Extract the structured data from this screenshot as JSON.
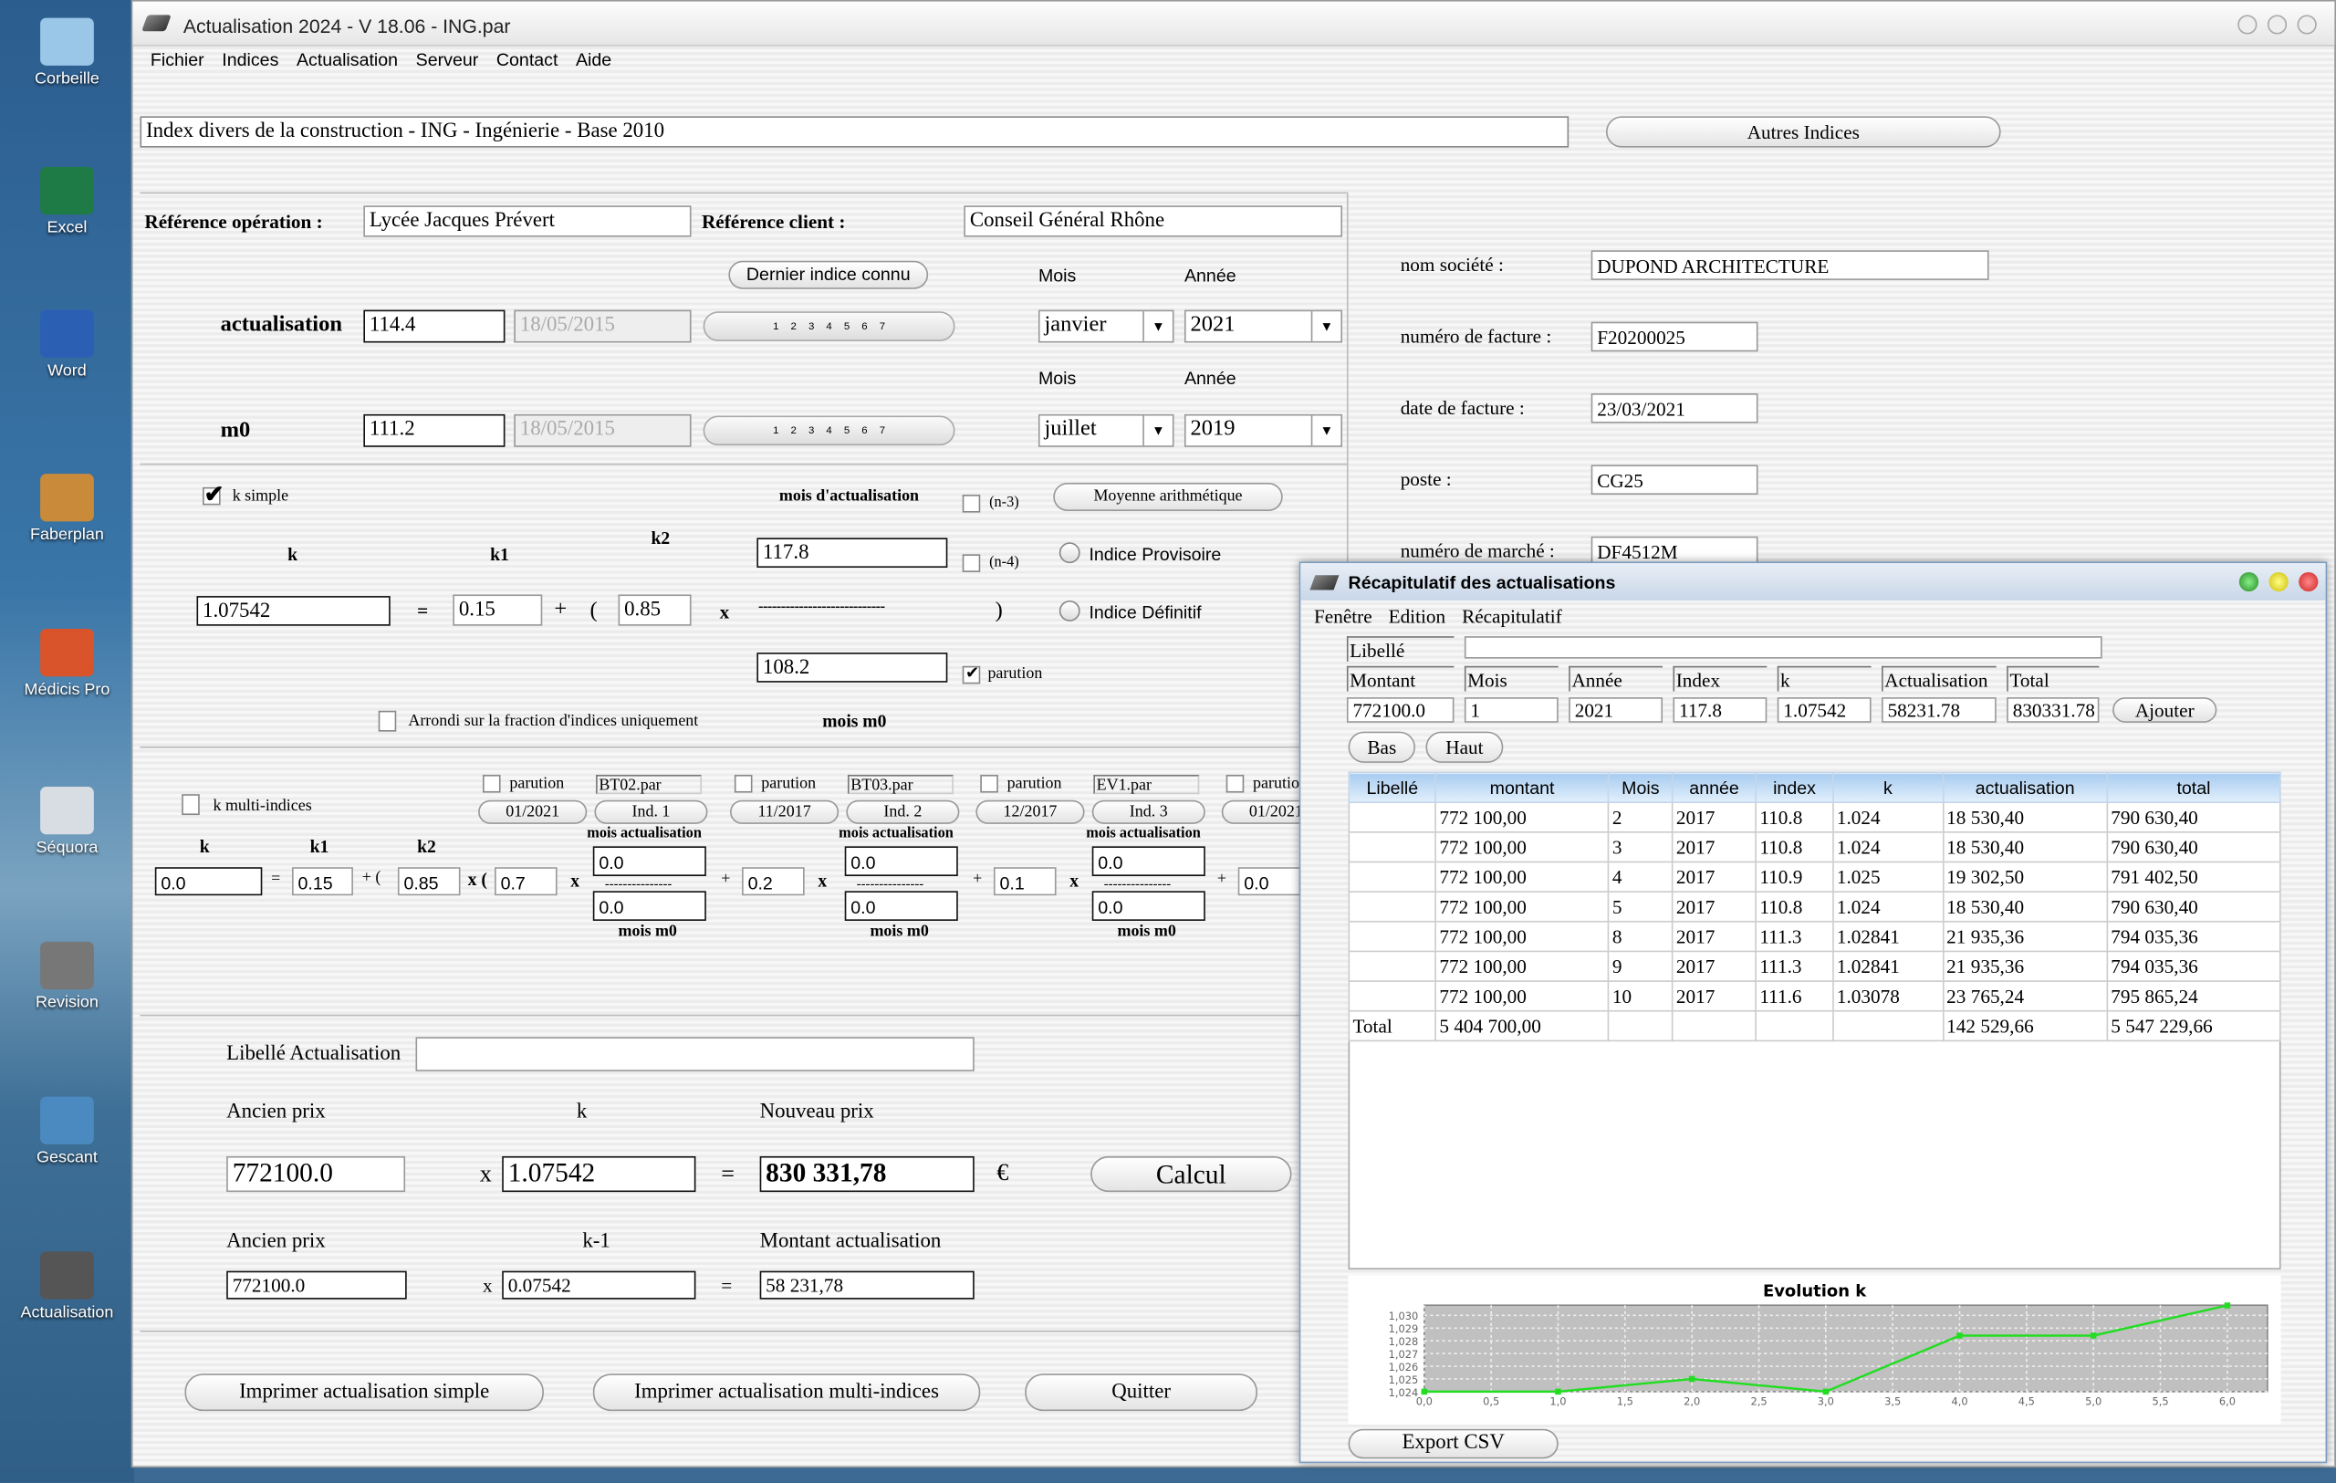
{
  "desktop": {
    "icons": [
      {
        "label": "Corbeille",
        "name": "recycle-bin-icon",
        "color": "#9ac6e8"
      },
      {
        "label": "Excel",
        "name": "excel-icon",
        "color": "#1e7b45"
      },
      {
        "label": "Word",
        "name": "word-icon",
        "color": "#2b5fb4"
      },
      {
        "label": "Faberplan",
        "name": "faberplan-icon",
        "color": "#c98a3a"
      },
      {
        "label": "Médicis Pro",
        "name": "medicis-pro-icon",
        "color": "#d9542b"
      },
      {
        "label": "Séquora",
        "name": "sequora-icon",
        "color": "#d8dde3"
      },
      {
        "label": "Revision",
        "name": "revision-icon",
        "color": "#777"
      },
      {
        "label": "Gescant",
        "name": "gescant-icon",
        "color": "#4a8ac0"
      },
      {
        "label": "Actualisation",
        "name": "actualisation-icon",
        "color": "#555"
      }
    ]
  },
  "window": {
    "title": "Actualisation 2024 - V 18.06 - ING.par",
    "menu": [
      "Fichier",
      "Indices",
      "Actualisation",
      "Serveur",
      "Contact",
      "Aide"
    ]
  },
  "index_name": "Index divers de la construction - ING - Ingénierie - Base 2010",
  "autres_indices": "Autres Indices",
  "ref": {
    "op_label": "Référence opération :",
    "op_value": "Lycée Jacques Prévert",
    "client_label": "Référence client :",
    "client_value": "Conseil Général Rhône"
  },
  "dernier_indice": "Dernier indice connu",
  "mois_label": "Mois",
  "annee_label": "Année",
  "pill_numbers": [
    "1",
    "2",
    "3",
    "4",
    "5",
    "6",
    "7"
  ],
  "actualisation": {
    "label": "actualisation",
    "value": "114.4",
    "date": "18/05/2015",
    "mois": "janvier",
    "annee": "2021"
  },
  "m0": {
    "label": "m0",
    "value": "111.2",
    "date": "18/05/2015",
    "mois": "juillet",
    "annee": "2019"
  },
  "simple": {
    "k_simple": "k simple",
    "k_simple_checked": true,
    "mois_actualisation": "mois d'actualisation",
    "n3": "(n-3)",
    "n4": "(n-4)",
    "moyenne": "Moyenne arithmétique",
    "k": "k",
    "k1": "k1",
    "k2": "k2",
    "k_value": "1.07542",
    "k1_value": "0.15",
    "k2_value": "0.85",
    "num": "117.8",
    "den": "108.2",
    "dashes": "----------------------------",
    "eq": "=",
    "plus": "+",
    "open": "(",
    "close": ")",
    "times": "x",
    "provisoire": "Indice Provisoire",
    "definitif": "Indice Définitif",
    "parution": "parution",
    "parution_checked": true,
    "arrondi": "Arrondi sur la fraction d'indices uniquement",
    "mois_m0": "mois m0"
  },
  "multi": {
    "label": "k multi-indices",
    "k": "k",
    "k1": "k1",
    "k2": "k2",
    "k_value": "0.0",
    "k1_value": "0.15",
    "k2_value": "0.85",
    "paren": "x (",
    "groups": [
      {
        "parution": "parution",
        "file": "BT02.par",
        "date": "01/2021",
        "ind": "Ind. 1",
        "coef": "0.7",
        "num": "0.0",
        "den": "0.0"
      },
      {
        "parution": "parution",
        "file": "BT03.par",
        "date": "11/2017",
        "ind": "Ind. 2",
        "coef": "0.2",
        "num": "0.0",
        "den": "0.0"
      },
      {
        "parution": "parution",
        "file": "EV1.par",
        "date": "12/2017",
        "ind": "Ind. 3",
        "coef": "0.1",
        "num": "0.0",
        "den": "0.0"
      },
      {
        "parution": "parutio",
        "date": "01/2021",
        "coef": "0.0"
      }
    ],
    "mois_act": "mois actualisation",
    "mois_m0": "mois m0",
    "dashes": "---------------"
  },
  "calc": {
    "libelle_label": "Libellé Actualisation",
    "libelle_value": "",
    "ancien_prix": "Ancien prix",
    "k": "k",
    "nouveau_prix": "Nouveau prix",
    "ancien_value": "772100.0",
    "k_value": "1.07542",
    "nouveau_value": "830 331,78",
    "euro": "€",
    "calcul": "Calcul",
    "k1_label": "k-1",
    "ancien_value2": "772100.0",
    "k1_value": "0.07542",
    "montant_label": "Montant actualisation",
    "montant_value": "58 231,78",
    "x": "x",
    "eq": "="
  },
  "buttons": {
    "print_simple": "Imprimer actualisation simple",
    "print_multi": "Imprimer actualisation multi-indices",
    "quit": "Quitter"
  },
  "client": {
    "societe_label": "nom société :",
    "societe": "DUPOND ARCHITECTURE",
    "facture_label": "numéro de facture :",
    "facture": "F20200025",
    "date_label": "date de facture :",
    "date": "23/03/2021",
    "poste_label": "poste :",
    "poste": "CG25",
    "marche_label": "numéro de marché :",
    "marche": "DF4512M"
  },
  "recap": {
    "title": "Récapitulatif des actualisations",
    "menu": [
      "Fenêtre",
      "Edition",
      "Récapitulatif"
    ],
    "libelle_label": "Libellé",
    "libelle_value": "",
    "entry_labels": [
      "Montant",
      "Mois",
      "Année",
      "Index",
      "k",
      "Actualisation",
      "Total"
    ],
    "entry_values": [
      "772100.0",
      "1",
      "2021",
      "117.8",
      "1.07542",
      "58231.78",
      "830331.78"
    ],
    "ajouter": "Ajouter",
    "bas": "Bas",
    "haut": "Haut",
    "columns": [
      "Libellé",
      "montant",
      "Mois",
      "année",
      "index",
      "k",
      "actualisation",
      "total"
    ],
    "rows": [
      [
        "",
        "772 100,00",
        "2",
        "2017",
        "110.8",
        "1.024",
        "18 530,40",
        "790 630,40"
      ],
      [
        "",
        "772 100,00",
        "3",
        "2017",
        "110.8",
        "1.024",
        "18 530,40",
        "790 630,40"
      ],
      [
        "",
        "772 100,00",
        "4",
        "2017",
        "110.9",
        "1.025",
        "19 302,50",
        "791 402,50"
      ],
      [
        "",
        "772 100,00",
        "5",
        "2017",
        "110.8",
        "1.024",
        "18 530,40",
        "790 630,40"
      ],
      [
        "",
        "772 100,00",
        "8",
        "2017",
        "111.3",
        "1.02841",
        "21 935,36",
        "794 035,36"
      ],
      [
        "",
        "772 100,00",
        "9",
        "2017",
        "111.3",
        "1.02841",
        "21 935,36",
        "794 035,36"
      ],
      [
        "",
        "772 100,00",
        "10",
        "2017",
        "111.6",
        "1.03078",
        "23 765,24",
        "795 865,24"
      ]
    ],
    "total_row": [
      "Total",
      "5 404 700,00",
      "",
      "",
      "",
      "",
      "142 529,66",
      "5 547 229,66"
    ],
    "export": "Export CSV"
  },
  "chart_data": {
    "type": "line",
    "title": "Evolution k",
    "x": [
      0,
      1,
      2,
      3,
      4,
      5,
      6
    ],
    "y": [
      1.024,
      1.024,
      1.025,
      1.024,
      1.02841,
      1.02841,
      1.03078
    ],
    "xlim": [
      0,
      6.3
    ],
    "ylim": [
      1.024,
      1.0308
    ],
    "xticks": [
      "0,0",
      "0,5",
      "1,0",
      "1,5",
      "2,0",
      "2,5",
      "3,0",
      "3,5",
      "4,0",
      "4,5",
      "5,0",
      "5,5",
      "6,0"
    ],
    "yticks": [
      "1,024",
      "1,025",
      "1,026",
      "1,027",
      "1,028",
      "1,029",
      "1,030"
    ],
    "grid": true,
    "line_color": "#22dd22",
    "plot_bg": "#c0c0c0"
  }
}
